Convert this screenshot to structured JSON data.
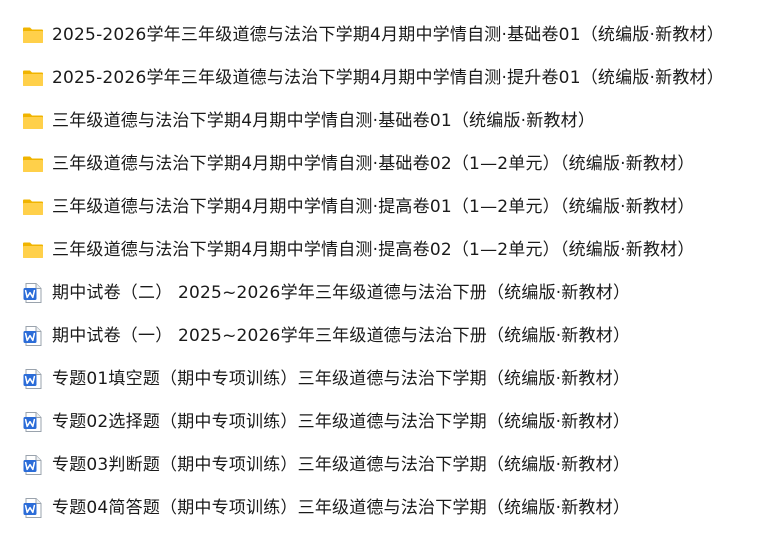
{
  "files": [
    {
      "type": "folder",
      "icon": "folder-icon",
      "name": "2025-2026学年三年级道德与法治下学期4月期中学情自测·基础卷01（统编版·新教材）"
    },
    {
      "type": "folder",
      "icon": "folder-icon",
      "name": "2025-2026学年三年级道德与法治下学期4月期中学情自测·提升卷01（统编版·新教材）"
    },
    {
      "type": "folder",
      "icon": "folder-icon",
      "name": "三年级道德与法治下学期4月期中学情自测·基础卷01（统编版·新教材）"
    },
    {
      "type": "folder",
      "icon": "folder-icon",
      "name": "三年级道德与法治下学期4月期中学情自测·基础卷02（1—2单元）（统编版·新教材）"
    },
    {
      "type": "folder",
      "icon": "folder-icon",
      "name": "三年级道德与法治下学期4月期中学情自测·提高卷01（1—2单元）（统编版·新教材）"
    },
    {
      "type": "folder",
      "icon": "folder-icon",
      "name": "三年级道德与法治下学期4月期中学情自测·提高卷02（1—2单元）（统编版·新教材）"
    },
    {
      "type": "doc",
      "icon": "word-document-icon",
      "name": "期中试卷（二） 2025~2026学年三年级道德与法治下册（统编版·新教材）"
    },
    {
      "type": "doc",
      "icon": "word-document-icon",
      "name": "期中试卷（一） 2025~2026学年三年级道德与法治下册（统编版·新教材）"
    },
    {
      "type": "doc",
      "icon": "word-document-icon",
      "name": "专题01填空题（期中专项训练）三年级道德与法治下学期（统编版·新教材）"
    },
    {
      "type": "doc",
      "icon": "word-document-icon",
      "name": "专题02选择题（期中专项训练）三年级道德与法治下学期（统编版·新教材）"
    },
    {
      "type": "doc",
      "icon": "word-document-icon",
      "name": "专题03判断题（期中专项训练）三年级道德与法治下学期（统编版·新教材）"
    },
    {
      "type": "doc",
      "icon": "word-document-icon",
      "name": "专题04简答题（期中专项训练）三年级道德与法治下学期（统编版·新教材）"
    }
  ],
  "colors": {
    "folder_back": "#f0b400",
    "folder_front": "#ffd04a",
    "word_blue": "#2b6cd8",
    "doc_border": "#9aa3ad"
  }
}
